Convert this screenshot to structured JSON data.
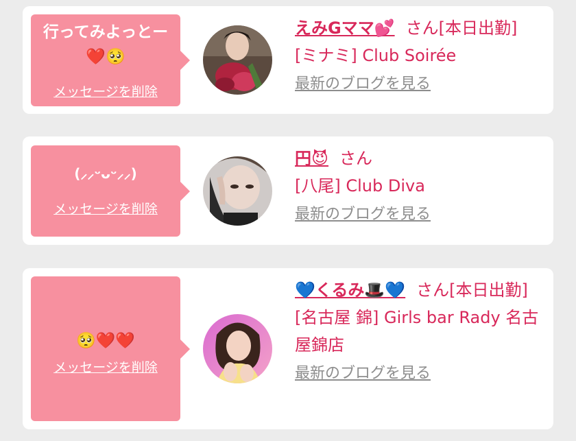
{
  "delete_label": "メッセージを削除",
  "blog_label": "最新のブログを見る",
  "messages": [
    {
      "message_line1": "行ってみよっとー",
      "message_line2": "❤️🥺",
      "name": "えみGママ💕",
      "suffix": "さん[本日出勤]",
      "store": "[ミナミ] Club Soirée"
    },
    {
      "message_line1": "(⸝⸝ᵕᴗᵕ⸝⸝)",
      "name": "円😈",
      "suffix": "さん",
      "store": "[八尾] Club Diva"
    },
    {
      "message_line1": "🥺❤️❤️",
      "name": "💙くるみ🎩💙",
      "suffix": "さん[本日出勤]",
      "store": "[名古屋 錦] Girls bar Rady 名古屋錦店"
    }
  ]
}
